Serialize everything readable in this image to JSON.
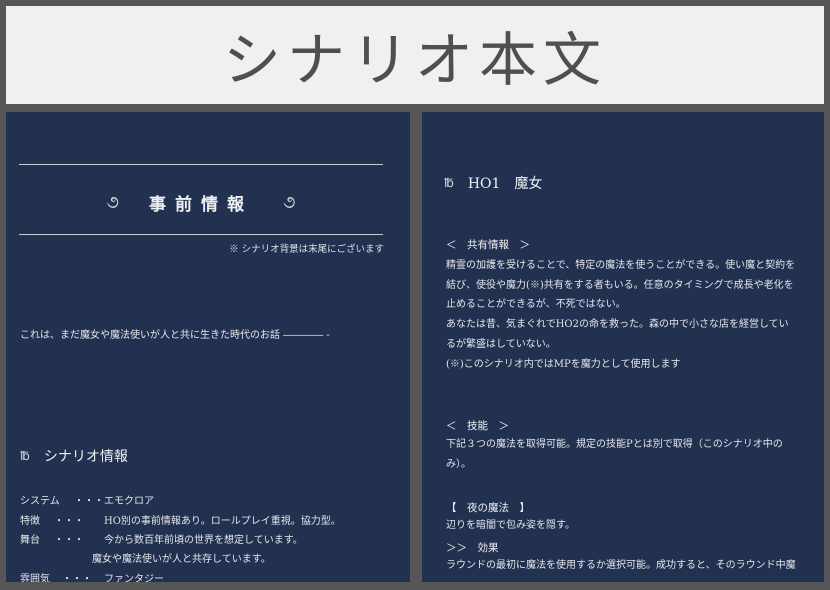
{
  "title": "シナリオ本文",
  "left_page": {
    "ornament_left": "૭",
    "heading": "事前情報",
    "ornament_right": "૭",
    "note": "※ シナリオ背景は末尾にございます",
    "intro": "これは、まだ魔女や魔法使いが人と共に生きた時代のお話 ―――― -",
    "section_mark": "℔",
    "section_title": "シナリオ情報",
    "sep": "・・・",
    "info": [
      {
        "label": "システム",
        "value": "エモクロア"
      },
      {
        "label": "特徴",
        "value": "HO別の事前情報あり。ロールプレイ重視。協力型。"
      },
      {
        "label": "舞台",
        "value": "今から数百年前頃の世界を想定しています。"
      },
      {
        "label": "",
        "value": "魔女や魔法使いが人と共存しています。"
      },
      {
        "label": "雰囲気",
        "value": "ファンタジー"
      }
    ]
  },
  "right_page": {
    "section_mark": "℔",
    "ho_title": "HO1　魔女",
    "shared_head": "＜　共有情報　＞",
    "shared_lines": [
      "精霊の加護を受けることで、特定の魔法を使うことができる。使い魔と契約を",
      "結び、使役や魔力(※)共有をする者もいる。任意のタイミングで成長や老化を",
      "止めることができるが、不死ではない。",
      "あなたは昔、気まぐれでHO2の命を救った。森の中で小さな店を経営してい",
      "るが繁盛はしていない。",
      "(※)このシナリオ内ではMPを魔力として使用します"
    ],
    "skill_head": "＜　技能　＞",
    "skill_lines": [
      "下記３つの魔法を取得可能。規定の技能Pとは別で取得（このシナリオ中の",
      "み）。"
    ],
    "magic_head": "【　夜の魔法　】",
    "magic_lines": [
      "辺りを暗闇で包み姿を隠す。"
    ],
    "effect_head": "＞＞　効果",
    "effect_lines": [
      "ラウンドの最初に魔法を使用するか選択可能。成功すると、そのラウンド中魔"
    ]
  }
}
